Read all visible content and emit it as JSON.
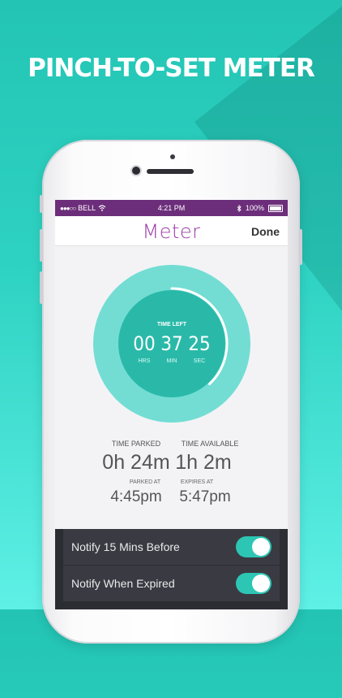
{
  "headline": "PINCH-TO-SET METER",
  "status_bar": {
    "carrier": "BELL",
    "time": "4:21 PM",
    "battery": "100%"
  },
  "nav": {
    "title": "Meter",
    "done_label": "Done"
  },
  "timer": {
    "label": "TIME LEFT",
    "hours": "00",
    "minutes": "37",
    "seconds": "25",
    "hours_unit": "HRS",
    "minutes_unit": "MIN",
    "seconds_unit": "SEC",
    "progress_fraction": 0.38
  },
  "stats": {
    "parked_label": "TIME PARKED",
    "parked_value": "0h 24m",
    "available_label": "TIME AVAILABLE",
    "available_value": "1h 2m",
    "parked_at_label": "PARKED AT",
    "parked_at_value": "4:45pm",
    "expires_at_label": "EXPIRES AT",
    "expires_at_value": "5:47pm"
  },
  "settings": [
    {
      "label": "Notify 15 Mins Before",
      "enabled": true
    },
    {
      "label": "Notify When Expired",
      "enabled": true
    }
  ],
  "colors": {
    "background": "#2fd3c3",
    "status_bar": "#6c2e7a",
    "title": "#9a3aa6",
    "ring_outer": "#73ddd4",
    "ring_inner": "#2ab9a9",
    "toggle_on": "#2dc6b5"
  }
}
